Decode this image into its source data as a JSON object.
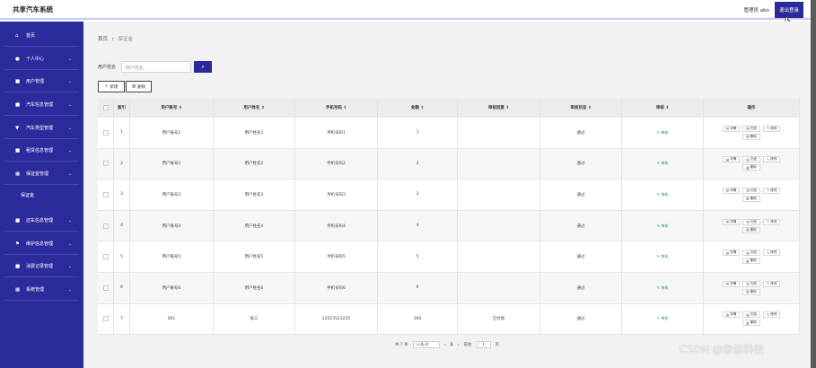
{
  "header": {
    "title": "共享汽车系统",
    "admin": "管理员 abo",
    "logout": "退出登录"
  },
  "sidebar": {
    "items": [
      {
        "label": "首页",
        "icon": "home-icon",
        "glyph": "⌂",
        "chev": ""
      },
      {
        "label": "个人中心",
        "icon": "user-icon",
        "glyph": "●",
        "chev": "⌄"
      },
      {
        "label": "用户管理",
        "icon": "users-icon",
        "glyph": "■",
        "chev": "⌄"
      },
      {
        "label": "汽车信息管理",
        "icon": "car-icon",
        "glyph": "■",
        "chev": "⌄"
      },
      {
        "label": "汽车类型管理",
        "icon": "type-icon",
        "glyph": "▼",
        "chev": "⌄"
      },
      {
        "label": "租赁信息管理",
        "icon": "rent-icon",
        "glyph": "■",
        "chev": "⌄"
      },
      {
        "label": "保证金管理",
        "icon": "grid-icon",
        "glyph": "▦",
        "chev": "⌄"
      },
      {
        "label": "还车信息管理",
        "icon": "return-icon",
        "glyph": "■",
        "chev": "⌄"
      },
      {
        "label": "维护信息管理",
        "icon": "flag-icon",
        "glyph": "⚑",
        "chev": "⌄"
      },
      {
        "label": "消费记录管理",
        "icon": "record-icon",
        "glyph": "■",
        "chev": "⌄"
      },
      {
        "label": "系统管理",
        "icon": "system-icon",
        "glyph": "▦",
        "chev": "⌄"
      }
    ],
    "sub": "保证金"
  },
  "breadcrumb": {
    "home": "首页",
    "sep": "/",
    "current": "保证金"
  },
  "search": {
    "label": "用户姓名",
    "placeholder": "用户姓名",
    "icon": "⌕"
  },
  "toolbar": {
    "add": "新增",
    "add_glyph": "+",
    "delete": "删除",
    "delete_glyph": "▥"
  },
  "table": {
    "headers": [
      "索引",
      "用户账号 ⇕",
      "用户姓名 ⇕",
      "手机号码 ⇕",
      "金额 ⇕",
      "审核回复 ⇕",
      "审核状态 ⇕",
      "审核 ⇕",
      "操作"
    ],
    "rows": [
      {
        "index": "1",
        "account": "用户账号1",
        "name": "用户姓名1",
        "phone": "手机号码1",
        "amount": "1",
        "reply": "",
        "status": "通过"
      },
      {
        "index": "2",
        "account": "用户账号2",
        "name": "用户姓名2",
        "phone": "手机号码2",
        "amount": "2",
        "reply": "",
        "status": "通过"
      },
      {
        "index": "3",
        "account": "用户账号3",
        "name": "用户姓名3",
        "phone": "手机号码3",
        "amount": "3",
        "reply": "",
        "status": "通过"
      },
      {
        "index": "4",
        "account": "用户账号4",
        "name": "用户姓名4",
        "phone": "手机号码4",
        "amount": "4",
        "reply": "",
        "status": "通过"
      },
      {
        "index": "5",
        "account": "用户账号5",
        "name": "用户姓名5",
        "phone": "手机号码5",
        "amount": "5",
        "reply": "",
        "status": "通过"
      },
      {
        "index": "6",
        "account": "用户账号6",
        "name": "用户姓名6",
        "phone": "手机号码6",
        "amount": "6",
        "reply": "",
        "status": "通过"
      },
      {
        "index": "7",
        "account": "001",
        "name": "张三",
        "phone": "13523523235",
        "amount": "300",
        "reply": "已付款",
        "status": "通过"
      }
    ],
    "audit_label": "审核",
    "audit_glyph": "✎",
    "ops": {
      "detail": "详情",
      "detail_glyph": "▤",
      "return": "归还",
      "return_glyph": "▤",
      "edit": "修改",
      "edit_glyph": "✎",
      "delete": "删除",
      "delete_glyph": "▥"
    }
  },
  "pager": {
    "total": "共 7 条",
    "page_size": "10条/页",
    "prev": "‹",
    "page": "1",
    "next": "›",
    "goto": "前往",
    "goto_value": "1",
    "unit": "页"
  },
  "watermark": "CSDN @幸运科技"
}
